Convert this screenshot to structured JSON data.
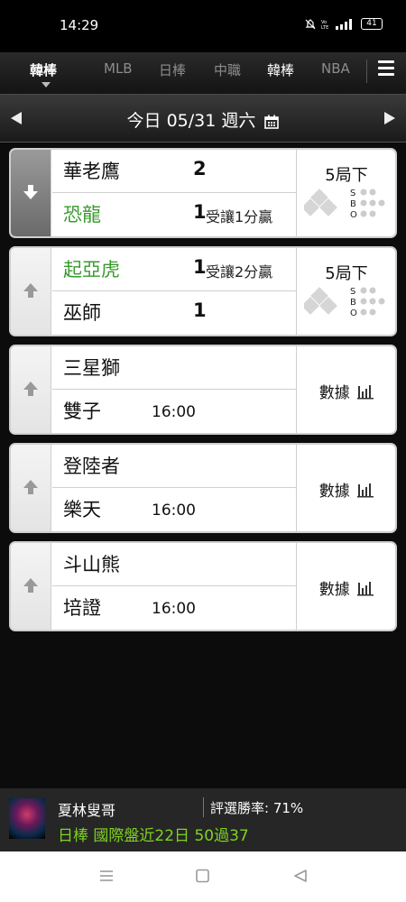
{
  "status": {
    "time": "14:29",
    "battery": "41"
  },
  "tabs": [
    {
      "label": "韓棒",
      "active": true
    },
    {
      "label": "MLB"
    },
    {
      "label": "日棒"
    },
    {
      "label": "中職"
    },
    {
      "label": "韓棒"
    },
    {
      "label": "NBA"
    }
  ],
  "date_bar": {
    "label": "今日 05/31 週六"
  },
  "games": [
    {
      "team1": "華老鷹",
      "team2": "恐龍",
      "score1": "2",
      "score2": "1",
      "handicap": "受讓1分贏",
      "handicap_row": 2,
      "inning": "5局下",
      "status": "live",
      "green_row": 2,
      "arrow": "down"
    },
    {
      "team1": "起亞虎",
      "team2": "巫師",
      "score1": "1",
      "score2": "1",
      "handicap": "受讓2分贏",
      "handicap_row": 1,
      "inning": "5局下",
      "status": "live",
      "green_row": 1,
      "arrow": "up"
    },
    {
      "team1": "三星獅",
      "team2": "雙子",
      "time": "16:00",
      "data_label": "數據",
      "status": "upcoming",
      "arrow": "up"
    },
    {
      "team1": "登陸者",
      "team2": "樂天",
      "time": "16:00",
      "data_label": "數據",
      "status": "upcoming",
      "arrow": "up"
    },
    {
      "team1": "斗山熊",
      "team2": "培證",
      "time": "16:00",
      "data_label": "數據",
      "status": "upcoming",
      "arrow": "up"
    }
  ],
  "sbo": {
    "s": "S",
    "b": "B",
    "o": "O"
  },
  "ad": {
    "name": "夏林叟哥",
    "rate": "評選勝率: 71%",
    "promo": "日棒 國際盤近22日 50過37"
  },
  "colors": {
    "accent_green": "#3a9a2e",
    "promo_green": "#7fd320"
  }
}
